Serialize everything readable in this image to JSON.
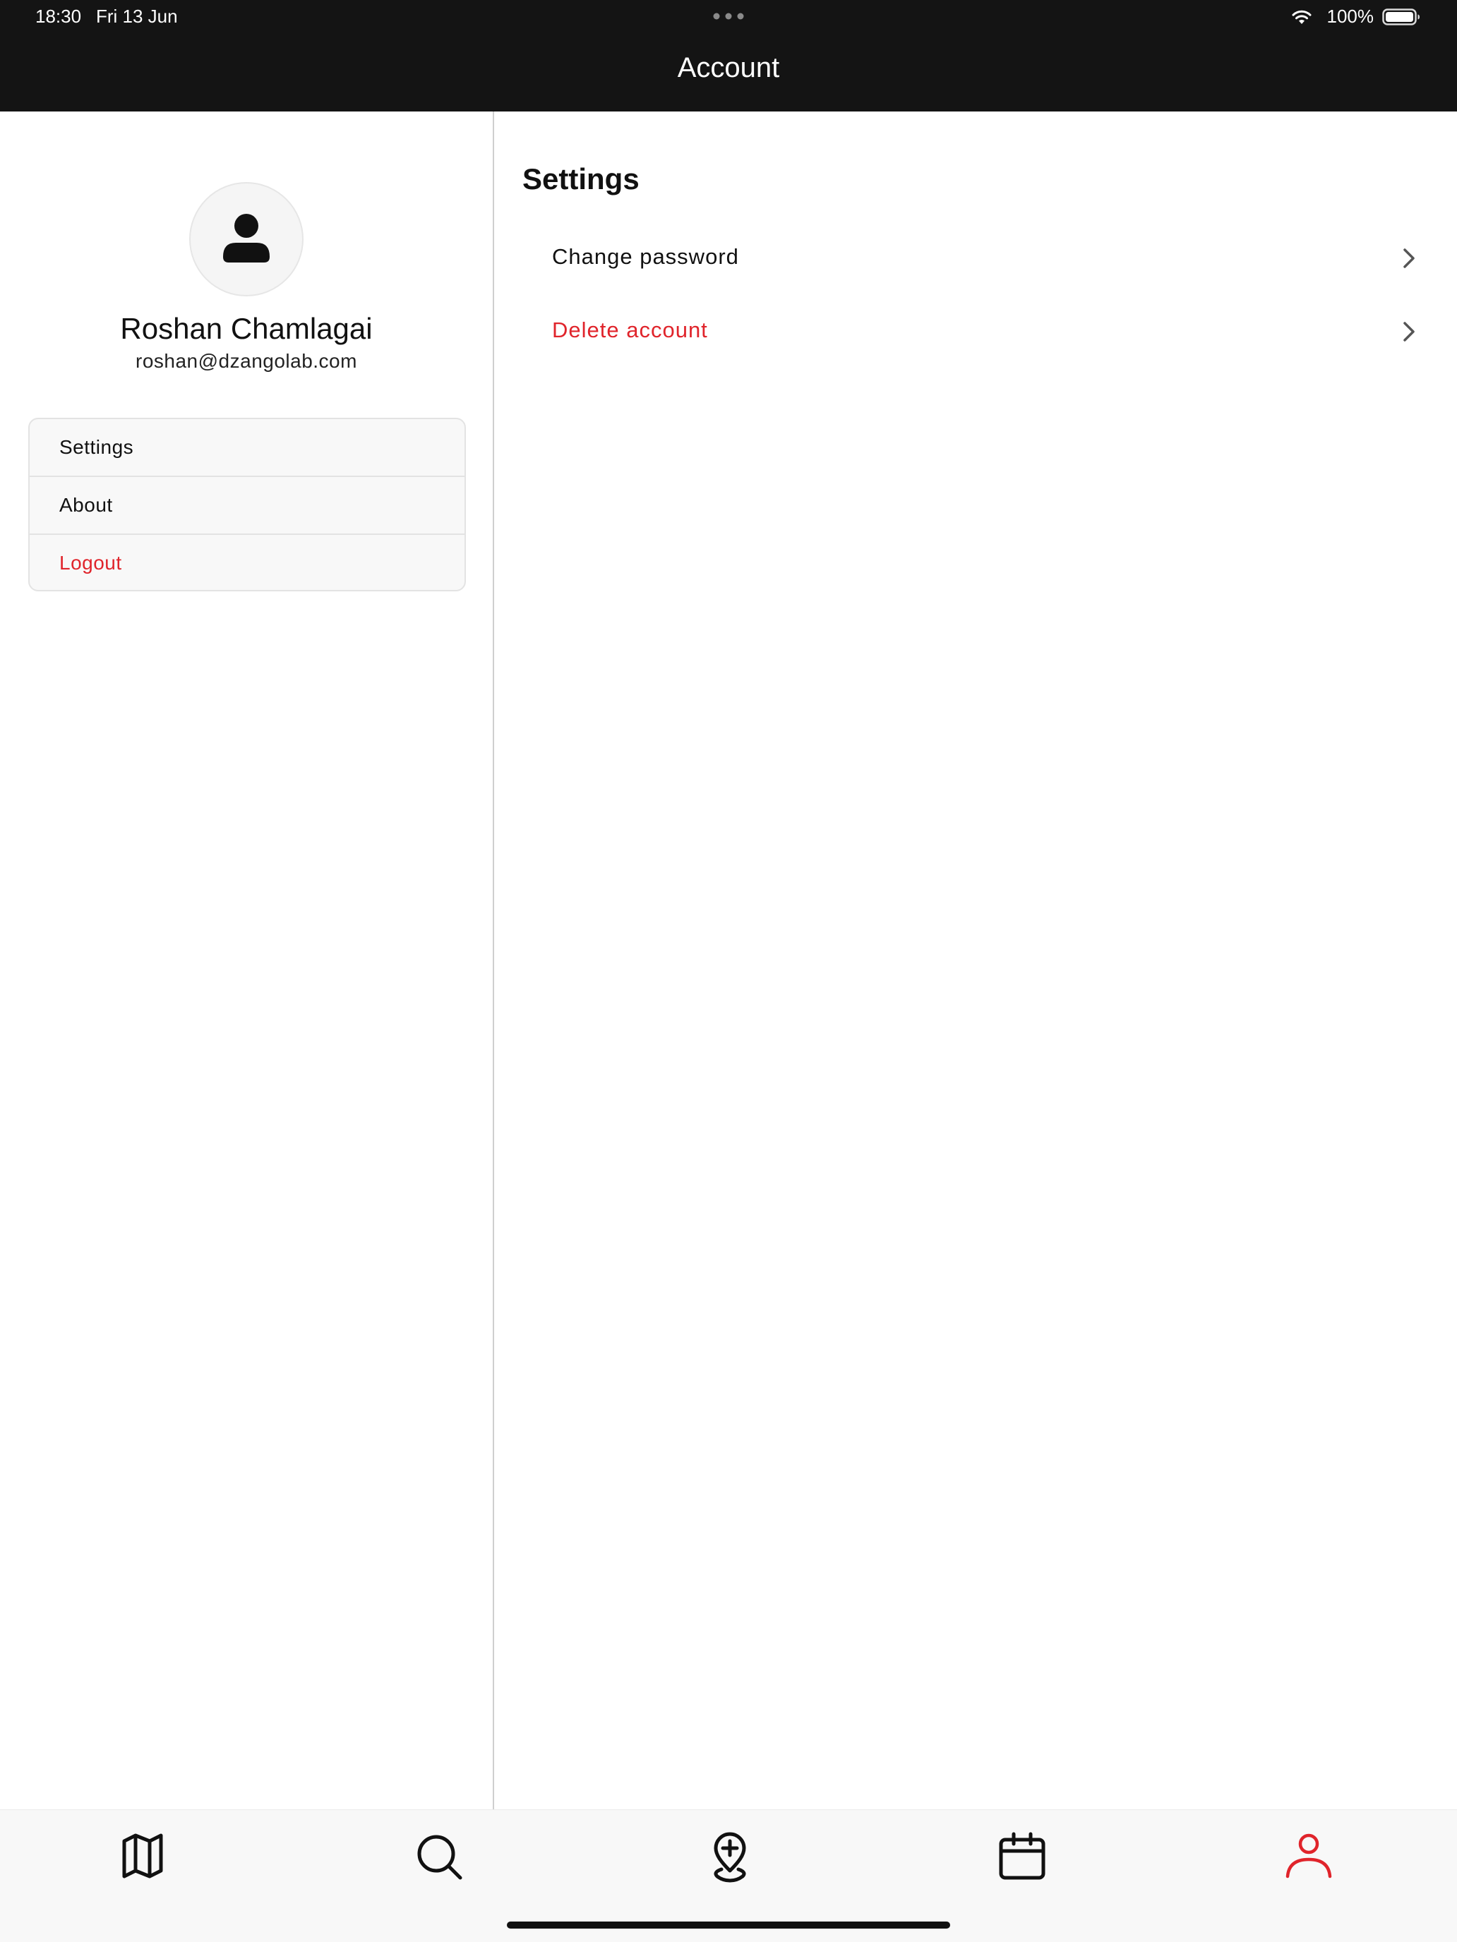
{
  "status_bar": {
    "time": "18:30",
    "date": "Fri 13 Jun",
    "battery": "100%"
  },
  "header": {
    "title": "Account"
  },
  "profile": {
    "name": "Roshan Chamlagai",
    "email": "roshan@dzangolab.com"
  },
  "sidebar_menu": {
    "items": [
      {
        "label": "Settings",
        "icon": "none"
      },
      {
        "label": "About",
        "icon": "none"
      },
      {
        "label": "Logout",
        "icon": "none",
        "color": "#e0242b"
      }
    ]
  },
  "settings_panel": {
    "title": "Settings",
    "rows": [
      {
        "label": "Change password",
        "icon": "chevron-right-icon"
      },
      {
        "label": "Delete account",
        "icon": "chevron-right-icon",
        "color": "#e0242b"
      }
    ]
  },
  "tab_bar": {
    "tabs": [
      {
        "icon": "map-icon",
        "active": false
      },
      {
        "icon": "search-icon",
        "active": false
      },
      {
        "icon": "add-location-icon",
        "active": false
      },
      {
        "icon": "calendar-icon",
        "active": false
      },
      {
        "icon": "user-icon",
        "active": true
      }
    ]
  },
  "colors": {
    "accent": "#e0242b",
    "header_bg": "#141414",
    "tab_bar_bg": "#f8f8f8"
  }
}
